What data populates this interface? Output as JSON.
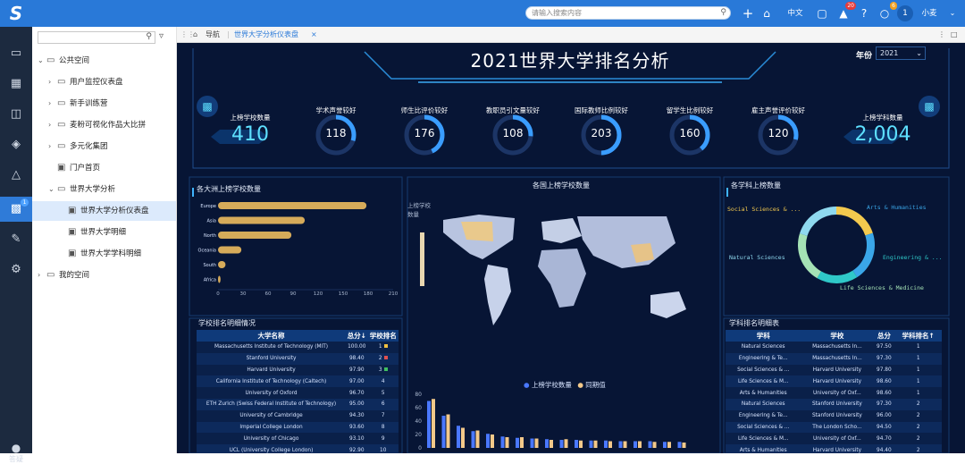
{
  "topbar": {
    "search_placeholder": "请输入搜索内容",
    "lang": "中文",
    "bell_badge": "20",
    "msg_badge": "6",
    "avatar": "1",
    "user": "小麦"
  },
  "leftnav": {
    "badge": "1",
    "help": "答疑"
  },
  "tree": {
    "items": [
      {
        "label": "公共空间",
        "level": 0,
        "open": true
      },
      {
        "label": "用户监控仪表盘",
        "level": 1
      },
      {
        "label": "新手训练营",
        "level": 1
      },
      {
        "label": "麦粉可视化作品大比拼",
        "level": 1
      },
      {
        "label": "多元化集团",
        "level": 1
      },
      {
        "label": "门户首页",
        "level": 1,
        "leaf": true
      },
      {
        "label": "世界大学分析",
        "level": 1,
        "open": true
      },
      {
        "label": "世界大学分析仪表盘",
        "level": 2,
        "selected": true
      },
      {
        "label": "世界大学明细",
        "level": 2
      },
      {
        "label": "世界大学学科明细",
        "level": 2
      },
      {
        "label": "我的空间",
        "level": 0
      }
    ]
  },
  "tabs": {
    "nav": "导航",
    "active": "世界大学分析仪表盘"
  },
  "dashboard": {
    "title": "2021世界大学排名分析",
    "year_label": "年份",
    "year_value": "2021",
    "kpi_left": {
      "label": "上榜学校数量",
      "value": "410"
    },
    "kpi_right": {
      "label": "上榜学科数量",
      "value": "2,004"
    },
    "rings": [
      {
        "label": "学术声誉较好",
        "value": "118",
        "frac": 0.3
      },
      {
        "label": "师生比评价较好",
        "value": "176",
        "frac": 0.43
      },
      {
        "label": "教职员引文量较好",
        "value": "108",
        "frac": 0.26
      },
      {
        "label": "国际教师比例较好",
        "value": "203",
        "frac": 0.5
      },
      {
        "label": "留学生比例较好",
        "value": "160",
        "frac": 0.39
      },
      {
        "label": "雇主声誉评价较好",
        "value": "120",
        "frac": 0.29
      }
    ],
    "continent_title": "各大洲上榜学校数量",
    "map_title": "各国上榜学校数量",
    "map_legend_label": "上榜学校数量",
    "subject_title": "各学科上榜数量",
    "school_table_title": "学校排名明细情况",
    "subject_table_title": "学科排名明细表",
    "legend": {
      "a": "上榜学校数量",
      "b": "同期值"
    }
  },
  "chart_data": [
    {
      "type": "bar",
      "orientation": "horizontal",
      "categories": [
        "Europe",
        "Asia",
        "North",
        "Oceania",
        "South",
        "Africa"
      ],
      "values": [
        178,
        104,
        88,
        28,
        9,
        3
      ],
      "xlim": [
        0,
        210
      ],
      "xticks": [
        0,
        30,
        60,
        90,
        120,
        150,
        180,
        210
      ]
    },
    {
      "type": "pie",
      "labels": [
        "Social Sciences & ...",
        "Arts & Humanities",
        "Engineering & ...",
        "Life Sciences & Medicine",
        "Natural Sciences"
      ],
      "values": [
        400,
        420,
        350,
        430,
        404
      ],
      "colors": [
        "#f3c94e",
        "#3aa6e8",
        "#2fc8c8",
        "#a5e2b5",
        "#8fd9ef"
      ]
    },
    {
      "type": "bar",
      "series": [
        {
          "name": "上榜学校数量",
          "values": [
            70,
            48,
            33,
            25,
            21,
            17,
            15,
            14,
            13,
            12,
            12,
            11,
            11,
            10,
            10,
            10,
            9,
            9
          ]
        },
        {
          "name": "同期值",
          "values": [
            73,
            50,
            30,
            26,
            20,
            16,
            16,
            14,
            12,
            13,
            11,
            11,
            10,
            10,
            10,
            9,
            9,
            8
          ]
        }
      ],
      "ylim": [
        0,
        80
      ],
      "yticks": [
        0,
        20,
        40,
        60,
        80
      ]
    }
  ],
  "school_table": {
    "headers": [
      "大学名称",
      "总分↓",
      "学校排名"
    ],
    "rows": [
      [
        "Massachusetts Institute of Technology (MIT)",
        "100.00",
        "1"
      ],
      [
        "Stanford University",
        "98.40",
        "2"
      ],
      [
        "Harvard University",
        "97.90",
        "3"
      ],
      [
        "California Institute of Technology (Caltech)",
        "97.00",
        "4"
      ],
      [
        "University of Oxford",
        "96.70",
        "5"
      ],
      [
        "ETH Zurich (Swiss Federal Institute of Technology)",
        "95.00",
        "6"
      ],
      [
        "University of Cambridge",
        "94.30",
        "7"
      ],
      [
        "Imperial College London",
        "93.60",
        "8"
      ],
      [
        "University of Chicago",
        "93.10",
        "9"
      ],
      [
        "UCL (University College London)",
        "92.90",
        "10"
      ]
    ]
  },
  "subject_table": {
    "headers": [
      "学科",
      "学校",
      "总分",
      "学科排名↑"
    ],
    "rows": [
      [
        "Natural Sciences",
        "Massachusetts In...",
        "97.50",
        "1"
      ],
      [
        "Engineering & Te...",
        "Massachusetts In...",
        "97.30",
        "1"
      ],
      [
        "Social Sciences & ...",
        "Harvard University",
        "97.80",
        "1"
      ],
      [
        "Life Sciences & M...",
        "Harvard University",
        "98.60",
        "1"
      ],
      [
        "Arts & Humanities",
        "University of Oxf...",
        "98.60",
        "1"
      ],
      [
        "Natural Sciences",
        "Stanford University",
        "97.30",
        "2"
      ],
      [
        "Engineering & Te...",
        "Stanford University",
        "96.00",
        "2"
      ],
      [
        "Social Sciences & ...",
        "The London Scho...",
        "94.50",
        "2"
      ],
      [
        "Life Sciences & M...",
        "University of Oxf...",
        "94.70",
        "2"
      ],
      [
        "Arts & Humanities",
        "Harvard University",
        "94.40",
        "2"
      ]
    ]
  }
}
